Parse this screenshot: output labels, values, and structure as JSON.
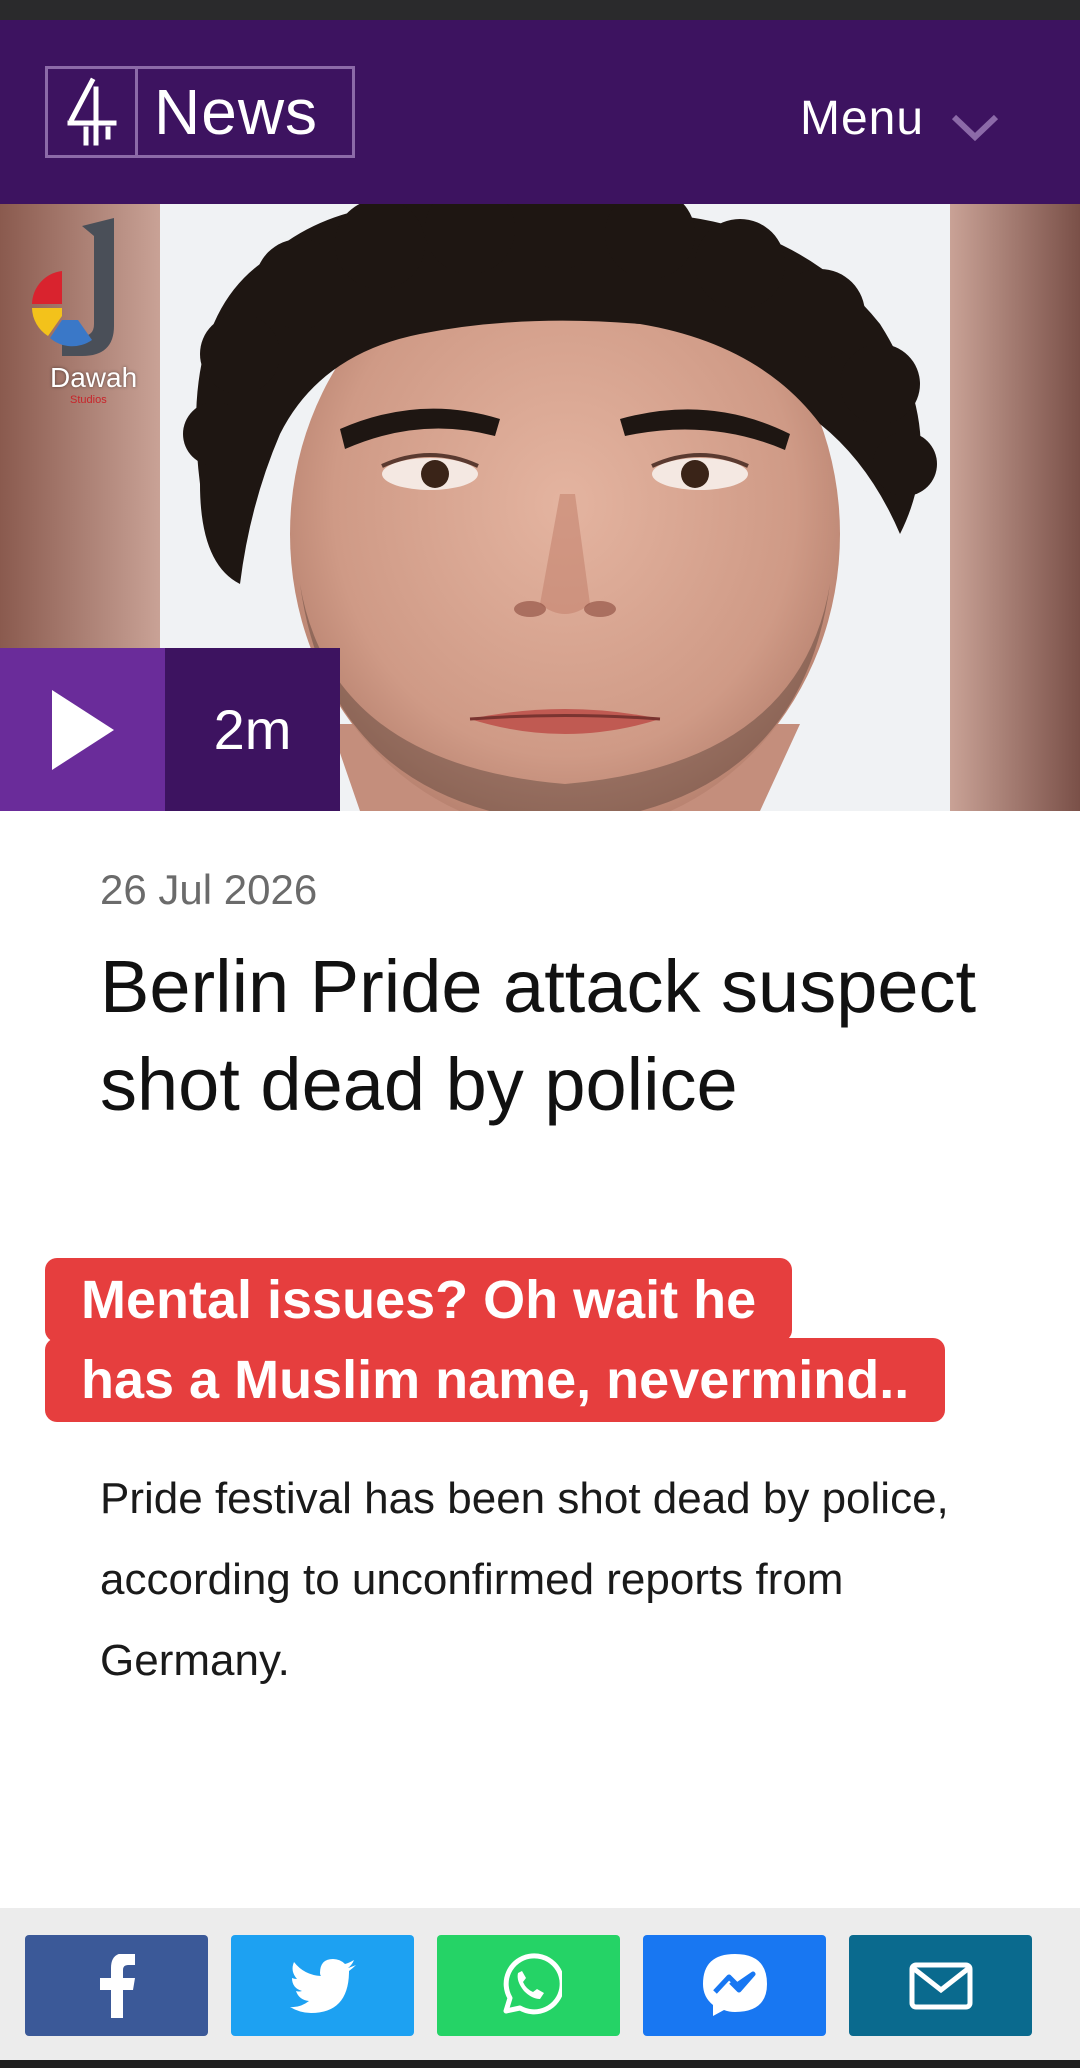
{
  "header": {
    "logo_mark": "4",
    "logo_text": "News",
    "menu_label": "Menu",
    "background_color": "#3d1360"
  },
  "hero": {
    "watermark_text": "Dawah",
    "watermark_subtext": "Studios",
    "duration": "2m",
    "play_icon": "play-icon"
  },
  "article": {
    "date": "26 Jul 2026",
    "headline": "Berlin Pride attack suspect shot dead by police",
    "caption_line1": "Mental issues? Oh wait he",
    "caption_line2": "has a Muslim name, nevermind..",
    "body": "Pride festival has been shot dead by police, according to unconfirmed reports from Germany."
  },
  "share": {
    "buttons": [
      {
        "name": "facebook",
        "icon": "facebook-icon",
        "color": "#3b5998"
      },
      {
        "name": "twitter",
        "icon": "twitter-icon",
        "color": "#1da1f2"
      },
      {
        "name": "whatsapp",
        "icon": "whatsapp-icon",
        "color": "#25d366"
      },
      {
        "name": "messenger",
        "icon": "messenger-icon",
        "color": "#1877f2"
      },
      {
        "name": "email",
        "icon": "email-icon",
        "color": "#0a6a8e"
      }
    ]
  },
  "colors": {
    "caption_bg": "#e63e3e",
    "play_bg": "#6a2c9a"
  }
}
